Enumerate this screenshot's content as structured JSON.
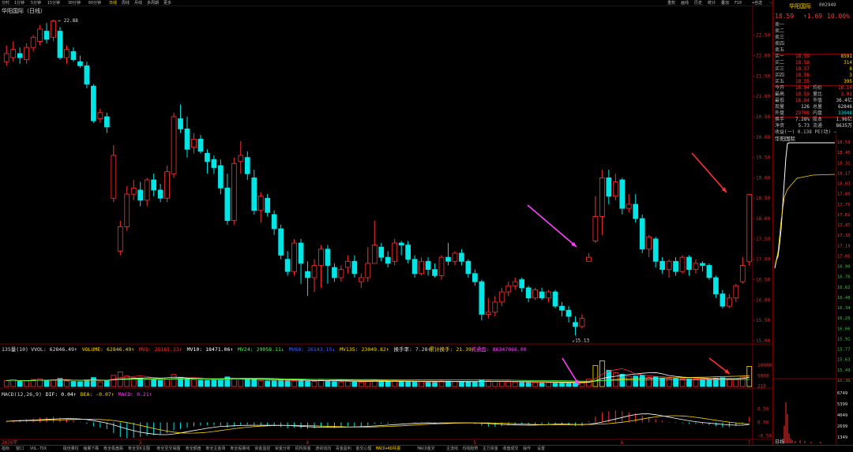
{
  "topbar": {
    "timeframes": [
      "分时",
      "1分钟",
      "5分钟",
      "15分钟",
      "30分钟",
      "60分钟",
      "日线",
      "周线",
      "月线",
      "多周期",
      "更多"
    ],
    "active_timeframe": "日线",
    "right_menu": [
      "重权",
      "画线",
      "历史",
      "统计",
      "叠加",
      "F10",
      "+自选",
      "-自选",
      "↑",
      "↓"
    ]
  },
  "stock": {
    "title": "华阳国际（日线）",
    "name": "华阳国际",
    "code": "002949",
    "price": "18.59",
    "change": "↑1.69",
    "pct": "10.00%"
  },
  "price_axis": [
    "22.50",
    "22.00",
    "21.50",
    "21.00",
    "20.50",
    "20.00",
    "19.50",
    "19.00",
    "18.50",
    "18.00",
    "17.50",
    "17.00",
    "16.50",
    "16.00",
    "15.50",
    "15.00"
  ],
  "annotations": {
    "high": "22.88",
    "low": "15.13"
  },
  "volume_header": {
    "title": "135量(10)",
    "vvol": "VVOL: 62846.49↑",
    "volume": "VOLUME: 62846.49↑",
    "mv5": "MV5: 25165.23↑",
    "mv10": "MV10: 18471.06↑",
    "mv24": "MV24: 29058.11↓",
    "mv60": "MV60: 26143.15↓",
    "mv135": "MV135: 23049.82↑",
    "turnover": "换手率: 7.28↑",
    "cum_turnover": "累计换手: 21.39↑",
    "float_shares": "流通盘: 86347066.00"
  },
  "volume_axis": [
    "10000",
    "5000",
    "210"
  ],
  "macd_header": {
    "title": "MACD(12,26,9)",
    "dif": "DIF: 0.04↑",
    "dea": "DEA: -0.07↑",
    "macd": "MACD: 0.21↑"
  },
  "macd_axis": [
    "0.50",
    "0.00",
    "-0.50"
  ],
  "date_axis": {
    "start": "2020年",
    "months": [
      "3",
      "4",
      "5",
      "6",
      "7"
    ]
  },
  "quote": {
    "asks": [
      {
        "label": "卖五",
        "price": "",
        "vol": ""
      },
      {
        "label": "卖四",
        "price": "",
        "vol": ""
      },
      {
        "label": "卖三",
        "price": "",
        "vol": ""
      },
      {
        "label": "卖二",
        "price": "",
        "vol": ""
      },
      {
        "label": "卖一",
        "price": "",
        "vol": ""
      }
    ],
    "bids": [
      {
        "label": "买一",
        "price": "18.59",
        "vol": "8591"
      },
      {
        "label": "买二",
        "price": "18.58",
        "vol": "314"
      },
      {
        "label": "买三",
        "price": "18.57",
        "vol": "8"
      },
      {
        "label": "买四",
        "price": "18.56",
        "vol": "3"
      },
      {
        "label": "买五",
        "price": "18.55",
        "vol": "395"
      }
    ],
    "stats": [
      {
        "l1": "今开",
        "v1": "16.94",
        "l2": "均价",
        "v2": "18.14"
      },
      {
        "l1": "最高",
        "v1": "18.59",
        "l2": "量比",
        "v2": "3.91"
      },
      {
        "l1": "最低",
        "v1": "16.84",
        "l2": "市值",
        "v2": "36.4亿"
      },
      {
        "l1": "现量",
        "v1": "126",
        "l2": "总量",
        "v2": "62846"
      },
      {
        "l1": "外盘",
        "v1": "29798",
        "l2": "内盘",
        "v2": "33048"
      }
    ],
    "stats2": [
      {
        "l1": "换手",
        "v1": "7.28%",
        "l2": "股本",
        "v2": "1.96亿"
      },
      {
        "l1": "净资",
        "v1": "5.73",
        "l2": "流通",
        "v2": "8635万"
      }
    ],
    "earnings": "收益(一) 0.138 PE(动) —"
  },
  "mini": {
    "name": "华阳国际",
    "price_axis": [
      "18.59",
      "18.45",
      "18.31",
      "18.17",
      "18.03",
      "17.89",
      "17.75",
      "17.61",
      "17.47",
      "17.33",
      "17.19",
      "17.05",
      "16.90",
      "16.76",
      "16.62",
      "16.48",
      "16.34",
      "16.20",
      "16.06",
      "15.91",
      "15.77",
      "15.63",
      "15.49",
      "15.35"
    ],
    "vol_axis": [
      "6749",
      "5399",
      "4049",
      "2699",
      "1349"
    ],
    "footer": "日线"
  },
  "bottombar": {
    "tabs": [
      "指标",
      "窗口",
      "VOL-TDX",
      "极佳量柱",
      "缩量下跌",
      "筹全极盘跌",
      "筹全至K主图",
      "筹全至交易图",
      "筹全额盘",
      "筹全主金场",
      "筹全股量线",
      "资金监控",
      "资金分析",
      "机构资金",
      "游资动向",
      "青金盈利",
      "金交心理",
      "MACD+KD共振",
      "MACD金叉",
      "主流线",
      "均线趋势",
      "主力资金",
      "收盘成交",
      "操作",
      "设置"
    ],
    "active_tab": "MACD+KD共振"
  },
  "colors": {
    "up": "#ff3030",
    "down": "#00e5e5",
    "ma5": "#ffffff",
    "ma10": "#ffd700",
    "ma20": "#ff40ff",
    "ma60": "#40ff40",
    "bg": "#000000"
  },
  "chart_data": {
    "type": "candlestick",
    "ylim": [
      15.0,
      22.9
    ],
    "candles": [
      [
        21.85,
        22.05,
        22.25,
        21.75
      ],
      [
        21.95,
        22.15,
        22.35,
        21.85
      ],
      [
        22.05,
        21.95,
        22.2,
        21.8
      ],
      [
        21.9,
        22.2,
        22.3,
        21.8
      ],
      [
        22.2,
        22.45,
        22.5,
        22.1
      ],
      [
        22.35,
        22.65,
        22.75,
        22.25
      ],
      [
        22.6,
        22.4,
        22.8,
        22.3
      ],
      [
        22.45,
        22.85,
        22.88,
        22.35
      ],
      [
        22.6,
        21.95,
        22.7,
        21.9
      ],
      [
        21.95,
        22.15,
        22.25,
        21.8
      ],
      [
        22.1,
        21.9,
        22.2,
        21.85
      ],
      [
        21.85,
        21.75,
        22.0,
        21.7
      ],
      [
        21.75,
        21.3,
        21.85,
        21.2
      ],
      [
        21.25,
        20.4,
        21.3,
        20.35
      ],
      [
        20.45,
        20.6,
        20.7,
        20.35
      ],
      [
        20.5,
        20.25,
        20.6,
        20.1
      ],
      [
        18.5,
        19.55,
        19.8,
        18.4
      ],
      [
        17.2,
        17.8,
        17.95,
        17.1
      ],
      [
        17.8,
        18.6,
        18.8,
        17.7
      ],
      [
        18.6,
        18.75,
        18.95,
        18.45
      ],
      [
        18.7,
        18.45,
        18.9,
        18.3
      ],
      [
        18.45,
        18.95,
        19.0,
        18.3
      ],
      [
        18.95,
        18.7,
        19.1,
        18.55
      ],
      [
        18.7,
        18.5,
        18.85,
        18.4
      ],
      [
        18.5,
        19.15,
        19.3,
        18.4
      ],
      [
        19.1,
        20.5,
        20.6,
        19.0
      ],
      [
        20.45,
        20.2,
        20.8,
        20.1
      ],
      [
        20.2,
        19.7,
        20.5,
        19.5
      ],
      [
        19.75,
        19.95,
        20.1,
        19.6
      ],
      [
        19.95,
        19.65,
        20.05,
        19.6
      ],
      [
        19.6,
        19.4,
        19.7,
        19.1
      ],
      [
        19.45,
        19.25,
        19.55,
        19.1
      ],
      [
        19.3,
        18.75,
        19.45,
        18.6
      ],
      [
        18.75,
        17.95,
        19.1,
        17.85
      ],
      [
        17.95,
        19.35,
        19.5,
        17.85
      ],
      [
        19.4,
        19.55,
        19.9,
        19.1
      ],
      [
        19.5,
        19.1,
        19.65,
        18.95
      ],
      [
        19.0,
        18.2,
        19.2,
        18.1
      ],
      [
        18.2,
        18.55,
        18.65,
        17.9
      ],
      [
        18.5,
        18.15,
        18.6,
        18.05
      ],
      [
        18.1,
        17.75,
        18.2,
        17.6
      ],
      [
        17.75,
        17.1,
        17.85,
        17.0
      ],
      [
        17.0,
        16.7,
        17.2,
        16.6
      ],
      [
        16.7,
        17.4,
        17.5,
        16.6
      ],
      [
        17.4,
        16.9,
        17.5,
        16.4
      ],
      [
        16.7,
        16.55,
        16.95,
        16.1
      ],
      [
        16.55,
        16.85,
        17.0,
        16.2
      ],
      [
        16.85,
        17.25,
        17.35,
        16.3
      ],
      [
        17.25,
        16.85,
        17.35,
        16.4
      ],
      [
        16.8,
        16.55,
        16.9,
        16.45
      ],
      [
        16.55,
        16.75,
        16.85,
        16.45
      ],
      [
        16.8,
        16.95,
        17.1,
        16.65
      ],
      [
        16.95,
        16.65,
        17.1,
        16.55
      ],
      [
        16.45,
        16.55,
        16.65,
        16.3
      ],
      [
        16.55,
        16.9,
        17.3,
        16.45
      ],
      [
        16.9,
        17.35,
        17.95,
        16.9
      ],
      [
        17.3,
        17.05,
        17.4,
        16.95
      ],
      [
        17.05,
        16.9,
        17.2,
        16.8
      ],
      [
        16.95,
        17.4,
        17.5,
        16.85
      ],
      [
        17.4,
        17.35,
        17.45,
        17.1
      ],
      [
        17.35,
        17.0,
        17.45,
        16.9
      ],
      [
        17.0,
        16.65,
        17.1,
        16.55
      ],
      [
        16.65,
        16.95,
        17.05,
        16.6
      ],
      [
        16.95,
        16.75,
        17.05,
        16.6
      ],
      [
        16.75,
        16.6,
        16.9,
        16.55
      ],
      [
        16.6,
        17.05,
        17.1,
        16.5
      ],
      [
        17.05,
        16.95,
        17.4,
        16.85
      ],
      [
        16.95,
        17.15,
        17.2,
        16.85
      ],
      [
        17.15,
        16.95,
        17.25,
        16.85
      ],
      [
        16.95,
        16.65,
        17.0,
        16.55
      ],
      [
        16.65,
        16.45,
        16.75,
        16.35
      ],
      [
        16.45,
        15.65,
        16.5,
        15.5
      ],
      [
        15.65,
        15.7,
        16.05,
        15.55
      ],
      [
        15.7,
        15.95,
        16.1,
        15.6
      ],
      [
        15.95,
        16.2,
        16.3,
        15.85
      ],
      [
        16.2,
        16.35,
        16.45,
        16.1
      ],
      [
        16.35,
        16.45,
        16.55,
        16.25
      ],
      [
        16.5,
        16.3,
        16.55,
        16.2
      ],
      [
        16.3,
        16.05,
        16.35,
        15.95
      ],
      [
        16.05,
        16.25,
        16.3,
        16.0
      ],
      [
        16.2,
        16.05,
        16.3,
        16.0
      ],
      [
        16.05,
        16.2,
        16.25,
        15.95
      ],
      [
        16.2,
        15.85,
        16.25,
        15.8
      ],
      [
        15.85,
        15.75,
        15.95,
        15.6
      ],
      [
        15.75,
        15.6,
        15.85,
        15.45
      ],
      [
        15.45,
        15.35,
        15.6,
        15.13
      ],
      [
        15.35,
        15.55,
        15.65,
        15.3
      ],
      [
        16.95,
        17.05,
        17.15,
        16.95
      ],
      [
        17.45,
        18.05,
        18.55,
        17.4
      ],
      [
        18.05,
        19.0,
        19.2,
        17.6
      ],
      [
        19.0,
        18.55,
        19.2,
        18.35
      ],
      [
        18.55,
        18.9,
        19.1,
        18.45
      ],
      [
        18.95,
        18.25,
        19.0,
        18.1
      ],
      [
        18.25,
        18.35,
        18.6,
        18.15
      ],
      [
        18.35,
        18.0,
        18.6,
        17.9
      ],
      [
        18.0,
        17.25,
        18.1,
        17.15
      ],
      [
        17.25,
        17.55,
        17.6,
        17.05
      ],
      [
        17.5,
        16.95,
        17.55,
        16.8
      ],
      [
        16.95,
        16.75,
        17.05,
        16.65
      ],
      [
        16.75,
        16.95,
        17.0,
        16.55
      ],
      [
        16.95,
        16.7,
        17.05,
        16.6
      ],
      [
        16.7,
        17.05,
        17.1,
        16.65
      ],
      [
        17.05,
        16.75,
        17.1,
        16.6
      ],
      [
        16.75,
        16.9,
        17.0,
        16.65
      ],
      [
        16.9,
        16.85,
        16.95,
        16.7
      ],
      [
        16.85,
        16.55,
        16.9,
        16.5
      ],
      [
        16.55,
        16.15,
        16.6,
        16.05
      ],
      [
        16.15,
        15.85,
        16.25,
        15.8
      ],
      [
        15.85,
        16.05,
        16.15,
        15.8
      ],
      [
        16.05,
        16.35,
        16.4,
        15.95
      ],
      [
        16.45,
        16.85,
        17.05,
        16.4
      ],
      [
        16.94,
        18.59,
        18.59,
        16.84
      ]
    ],
    "volume": [
      2800,
      3100,
      2400,
      2600,
      3300,
      3600,
      2900,
      3200,
      3800,
      2600,
      2400,
      2300,
      3100,
      4200,
      2200,
      2800,
      5200,
      6800,
      4900,
      4100,
      3800,
      3500,
      3300,
      2900,
      3600,
      5600,
      4300,
      3900,
      3200,
      3000,
      2900,
      3100,
      3300,
      4500,
      3800,
      3600,
      3200,
      3400,
      2800,
      2600,
      2700,
      3200,
      3000,
      2700,
      2900,
      2500,
      2400,
      3100,
      2700,
      2300,
      2200,
      2400,
      2300,
      2100,
      2500,
      3100,
      2400,
      2300,
      2600,
      2300,
      2200,
      2100,
      2300,
      2200,
      2100,
      2600,
      2500,
      2400,
      2300,
      2200,
      2000,
      3100,
      2600,
      2400,
      2300,
      2200,
      2100,
      2000,
      1900,
      1800,
      1900,
      1800,
      1700,
      1600,
      1700,
      1900,
      1800,
      3400,
      9800,
      12000,
      7600,
      6400,
      5700,
      4800,
      4900,
      5300,
      4200,
      4500,
      3900,
      3800,
      3700,
      3500,
      3600,
      3400,
      3300,
      3700,
      3900,
      4100,
      3500,
      3600,
      4400,
      9400
    ],
    "macd": [
      0.05,
      0.08,
      0.1,
      0.12,
      0.15,
      0.18,
      0.2,
      0.22,
      0.18,
      0.12,
      0.08,
      0.02,
      -0.05,
      -0.15,
      -0.2,
      -0.25,
      -0.4,
      -0.55,
      -0.6,
      -0.58,
      -0.55,
      -0.5,
      -0.48,
      -0.45,
      -0.4,
      -0.3,
      -0.25,
      -0.2,
      -0.15,
      -0.12,
      -0.1,
      -0.1,
      -0.12,
      -0.2,
      -0.15,
      -0.1,
      -0.08,
      -0.1,
      -0.1,
      -0.12,
      -0.14,
      -0.18,
      -0.22,
      -0.2,
      -0.22,
      -0.24,
      -0.22,
      -0.18,
      -0.18,
      -0.2,
      -0.18,
      -0.15,
      -0.15,
      -0.16,
      -0.12,
      -0.05,
      -0.04,
      -0.05,
      -0.02,
      0.0,
      0.0,
      -0.03,
      -0.02,
      -0.03,
      -0.05,
      -0.02,
      0.0,
      0.01,
      0.0,
      -0.03,
      -0.06,
      -0.12,
      -0.16,
      -0.16,
      -0.14,
      -0.11,
      -0.08,
      -0.07,
      -0.08,
      -0.07,
      -0.07,
      -0.06,
      -0.07,
      -0.09,
      -0.11,
      -0.14,
      -0.13,
      0.05,
      0.22,
      0.38,
      0.42,
      0.45,
      0.42,
      0.38,
      0.34,
      0.26,
      0.2,
      0.12,
      0.06,
      0.02,
      -0.02,
      -0.03,
      -0.05,
      -0.06,
      -0.07,
      -0.1,
      -0.14,
      -0.18,
      -0.18,
      -0.14,
      -0.06,
      0.21
    ]
  }
}
